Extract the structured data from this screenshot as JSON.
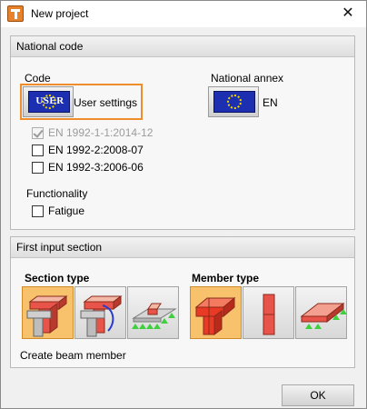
{
  "window": {
    "title": "New project",
    "close_glyph": "✕",
    "icon": "app-t-icon"
  },
  "national_code": {
    "header": "National code",
    "code_label": "Code",
    "code_flag_overlay": "USER",
    "code_value": "User settings",
    "annex_label": "National annex",
    "annex_value": "EN",
    "standards": [
      {
        "label": "EN 1992-1-1:2014-12",
        "checked": true,
        "disabled": true
      },
      {
        "label": "EN 1992-2:2008-07",
        "checked": false,
        "disabled": false
      },
      {
        "label": "EN 1992-3:2006-06",
        "checked": false,
        "disabled": false
      }
    ],
    "functionality_label": "Functionality",
    "fatigue_label": "Fatigue",
    "flag_color": "#1b2fb0",
    "highlight_color": "#ef8d2d"
  },
  "first_input": {
    "header": "First input section",
    "section_type_label": "Section type",
    "member_type_label": "Member type",
    "section_tiles": [
      "t-section-icon",
      "t-section-curved-icon",
      "beam-on-supports-icon"
    ],
    "member_tiles": [
      "beam-member-icon",
      "column-member-icon",
      "slab-member-icon"
    ],
    "selected_color": "#f7c26b",
    "description": "Create beam member"
  },
  "footer": {
    "ok_label": "OK"
  }
}
